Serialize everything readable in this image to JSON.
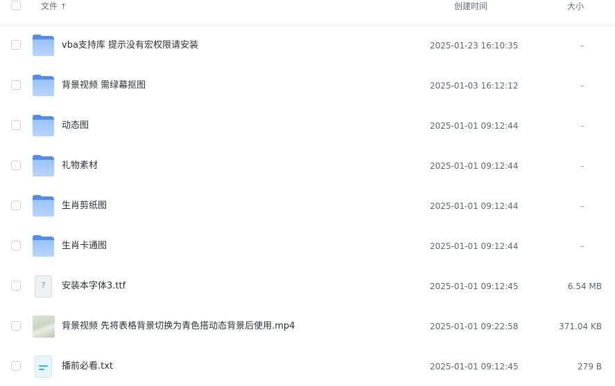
{
  "header": {
    "name_label": "文件",
    "sort_icon": "↑",
    "time_label": "创建时间",
    "size_label": "大小"
  },
  "files": [
    {
      "name": "vba支持库 提示没有宏权限请安装",
      "time": "2025-01-23 16:10:35",
      "size": "-",
      "icon": "folder-icon"
    },
    {
      "name": "背景视频 需绿幕抠图",
      "time": "2025-01-03 16:12:12",
      "size": "-",
      "icon": "folder-icon"
    },
    {
      "name": "动态图",
      "time": "2025-01-01 09:12:44",
      "size": "-",
      "icon": "folder-icon"
    },
    {
      "name": "礼物素材",
      "time": "2025-01-01 09:12:44",
      "size": "-",
      "icon": "folder-icon"
    },
    {
      "name": "生肖剪纸图",
      "time": "2025-01-01 09:12:44",
      "size": "-",
      "icon": "folder-icon"
    },
    {
      "name": "生肖卡通图",
      "time": "2025-01-01 09:12:44",
      "size": "-",
      "icon": "folder-icon"
    },
    {
      "name": "安装本字体3.ttf",
      "time": "2025-01-01 09:12:45",
      "size": "6.54 MB",
      "icon": "unknown-file-icon",
      "icon_glyph": "?"
    },
    {
      "name": "背景视频 先将表格背景切换为青色搭动态背景后使用.mp4",
      "time": "2025-01-01 09:22:58",
      "size": "371.04 KB",
      "icon": "video-thumbnail"
    },
    {
      "name": "播前必看.txt",
      "time": "2025-01-01 09:12:45",
      "size": "279 B",
      "icon": "txt-file-icon"
    }
  ],
  "colors": {
    "folder_dark": "#4f8ef0",
    "folder_light": "#b7d4fd",
    "txt_accent": "#29b6f2",
    "text_primary": "#2b2f36",
    "text_secondary": "#5f6670"
  }
}
